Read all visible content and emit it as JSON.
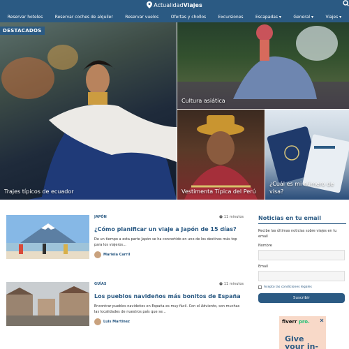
{
  "header": {
    "logo_prefix": "Actualidad",
    "logo_bold": "Viajes",
    "nav": [
      {
        "label": "Reservar hoteles"
      },
      {
        "label": "Reservar coches de alquiler"
      },
      {
        "label": "Reservar vuelos"
      },
      {
        "label": "Ofertas y chollos"
      },
      {
        "label": "Excursiones"
      },
      {
        "label": "Escapadas ▾"
      },
      {
        "label": "General ▾"
      },
      {
        "label": "Viajes ▾"
      }
    ]
  },
  "featured": {
    "badge": "DESTACADOS",
    "tiles": [
      {
        "caption": "Trajes típicos de ecuador"
      },
      {
        "caption": "Cultura asiática"
      },
      {
        "caption": "Vestimenta Típica del Perú"
      },
      {
        "caption": "¿Cuál es mi número de visa?"
      }
    ]
  },
  "articles": [
    {
      "category": "JAPÓN",
      "read_time": "11 minutos",
      "title": "¿Cómo planificar un viaje a Japón de 15 días?",
      "excerpt": "De un tiempo a esta parte Japón se ha convertido en uno de los destinos más top para los viajeros...",
      "author": "Mariela Carril"
    },
    {
      "category": "GUÍAS",
      "read_time": "11 minutos",
      "title": "Los pueblos navideños más bonitos de España",
      "excerpt": "Encontrar pueblos navideños en España es muy fácil. Con el Adviento, son muchas las localidades de nuestros país que se...",
      "author": "Luis Martinez"
    }
  ],
  "newsletter": {
    "title": "Noticias en tu email",
    "text": "Recibe las últimas noticias sobre viajes en tu email",
    "name_label": "Nombre",
    "email_label": "Email",
    "terms": "Acepto las condiciones legales",
    "submit": "Suscribir"
  },
  "ad": {
    "brand": "fiverr",
    "brand_suffix": "pro.",
    "text": "Give your in-house"
  },
  "colors": {
    "primary": "#2b5a83",
    "ad_bg": "#f8d9c8"
  }
}
